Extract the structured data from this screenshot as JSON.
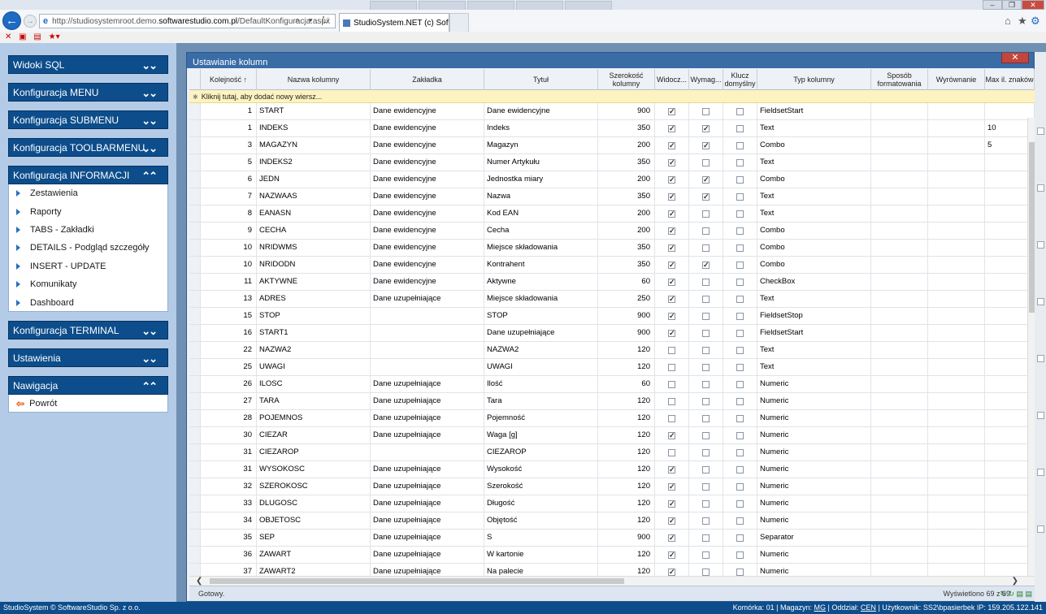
{
  "browser": {
    "url_prefix": "http://studiosystemroot.demo.",
    "url_domain": "softwarestudio.com.pl",
    "url_path": "/DefaultKonfiguracja.aspx",
    "url_tools": "⌕ ▾ ↻",
    "tab_title": "StudioSystem.NET (c) Soft...",
    "tab_close": "✕",
    "back_symbol": "←",
    "forward_symbol": "→",
    "ie_symbol": "e",
    "home_symbol": "⌂",
    "star_symbol": "★",
    "gear_symbol": "⚙",
    "favs": [
      "✕",
      "▣",
      "▤",
      "★▾"
    ]
  },
  "window": {
    "minimize": "–",
    "maximize": "❐",
    "close": "✕"
  },
  "sidebar": {
    "sections": [
      {
        "label": "Widoki SQL",
        "chevron": "⌄⌄"
      },
      {
        "label": "Konfiguracja MENU",
        "chevron": "⌄⌄"
      },
      {
        "label": "Konfiguracja SUBMENU",
        "chevron": "⌄⌄"
      },
      {
        "label": "Konfiguracja TOOLBARMENU",
        "chevron": "⌄⌄"
      },
      {
        "label": "Konfiguracja INFORMACJI",
        "chevron": "⌃⌃"
      },
      {
        "label": "Konfiguracja TERMINAL",
        "chevron": "⌄⌄"
      },
      {
        "label": "Ustawienia",
        "chevron": "⌄⌄"
      },
      {
        "label": "Nawigacja",
        "chevron": "⌃⌃"
      }
    ],
    "informacji_items": [
      "Zestawienia",
      "Raporty",
      "TABS - Zakładki",
      "DETAILS - Podgląd szczegóły",
      "INSERT - UPDATE",
      "Komunikaty",
      "Dashboard"
    ],
    "nawigacja_items": [
      "Powrót"
    ],
    "back_arrow": "⇦"
  },
  "modal": {
    "title": "Ustawianie kolumn",
    "close": "✕",
    "add_row": "Kliknij tutaj, aby dodać nowy wiersz...",
    "add_row_icon": "✱",
    "status_left": "Gotowy.",
    "status_right": "Wyświetlono 69 z 69",
    "status_icons": "↻ ↻ ▤ ▤",
    "scroll_left": "❮",
    "scroll_right": "❯"
  },
  "columns": [
    "Kolejność ↑",
    "Nazwa kolumny",
    "Zakładka",
    "Tytuł",
    "Szerokość kolumny",
    "Widocz...",
    "Wymag...",
    "Klucz domyślny",
    "Typ kolumny",
    "Sposób formatowania",
    "Wyrównanie",
    "Max il. znaków"
  ],
  "check_mark": "✓",
  "rows": [
    {
      "order": "1",
      "name": "START",
      "tab": "Dane ewidencyjne",
      "title": "Dane ewidencyjne",
      "width": "900",
      "visible": true,
      "required": false,
      "key": false,
      "type": "FieldsetStart",
      "max": ""
    },
    {
      "order": "1",
      "name": "INDEKS",
      "tab": "Dane ewidencyjne",
      "title": "Indeks",
      "width": "350",
      "visible": true,
      "required": true,
      "key": false,
      "type": "Text",
      "max": "10"
    },
    {
      "order": "3",
      "name": "MAGAZYN",
      "tab": "Dane ewidencyjne",
      "title": "Magazyn",
      "width": "200",
      "visible": true,
      "required": true,
      "key": false,
      "type": "Combo",
      "max": "5"
    },
    {
      "order": "5",
      "name": "INDEKS2",
      "tab": "Dane ewidencyjne",
      "title": "Numer Artykułu",
      "width": "350",
      "visible": true,
      "required": false,
      "key": false,
      "type": "Text",
      "max": ""
    },
    {
      "order": "6",
      "name": "JEDN",
      "tab": "Dane ewidencyjne",
      "title": "Jednostka miary",
      "width": "200",
      "visible": true,
      "required": true,
      "key": false,
      "type": "Combo",
      "max": ""
    },
    {
      "order": "7",
      "name": "NAZWAAS",
      "tab": "Dane ewidencyjne",
      "title": "Nazwa",
      "width": "350",
      "visible": true,
      "required": true,
      "key": false,
      "type": "Text",
      "max": ""
    },
    {
      "order": "8",
      "name": "EANASN",
      "tab": "Dane ewidencyjne",
      "title": "Kod EAN",
      "width": "200",
      "visible": true,
      "required": false,
      "key": false,
      "type": "Text",
      "max": ""
    },
    {
      "order": "9",
      "name": "CECHA",
      "tab": "Dane ewidencyjne",
      "title": "Cecha",
      "width": "200",
      "visible": true,
      "required": false,
      "key": false,
      "type": "Combo",
      "max": ""
    },
    {
      "order": "10",
      "name": "NRIDWMS",
      "tab": "Dane ewidencyjne",
      "title": "Miejsce składowania",
      "width": "350",
      "visible": true,
      "required": false,
      "key": false,
      "type": "Combo",
      "max": ""
    },
    {
      "order": "10",
      "name": "NRIDODN",
      "tab": "Dane ewidencyjne",
      "title": "Kontrahent",
      "width": "350",
      "visible": true,
      "required": true,
      "key": false,
      "type": "Combo",
      "max": ""
    },
    {
      "order": "11",
      "name": "AKTYWNE",
      "tab": "Dane ewidencyjne",
      "title": "Aktywne",
      "width": "60",
      "visible": true,
      "required": false,
      "key": false,
      "type": "CheckBox",
      "max": ""
    },
    {
      "order": "13",
      "name": "ADRES",
      "tab": "Dane uzupełniające",
      "title": "Miejsce składowania",
      "width": "250",
      "visible": true,
      "required": false,
      "key": false,
      "type": "Text",
      "max": ""
    },
    {
      "order": "15",
      "name": "STOP",
      "tab": "",
      "title": "STOP",
      "width": "900",
      "visible": true,
      "required": false,
      "key": false,
      "type": "FieldsetStop",
      "max": ""
    },
    {
      "order": "16",
      "name": "START1",
      "tab": "",
      "title": "Dane uzupełniające",
      "width": "900",
      "visible": true,
      "required": false,
      "key": false,
      "type": "FieldsetStart",
      "max": ""
    },
    {
      "order": "22",
      "name": "NAZWA2",
      "tab": "",
      "title": "NAZWA2",
      "width": "120",
      "visible": false,
      "required": false,
      "key": false,
      "type": "Text",
      "max": ""
    },
    {
      "order": "25",
      "name": "UWAGI",
      "tab": "",
      "title": "UWAGI",
      "width": "120",
      "visible": false,
      "required": false,
      "key": false,
      "type": "Text",
      "max": ""
    },
    {
      "order": "26",
      "name": "ILOSC",
      "tab": "Dane uzupełniające",
      "title": "Ilość",
      "width": "60",
      "visible": false,
      "required": false,
      "key": false,
      "type": "Numeric",
      "max": ""
    },
    {
      "order": "27",
      "name": "TARA",
      "tab": "Dane uzupełniające",
      "title": "Tara",
      "width": "120",
      "visible": false,
      "required": false,
      "key": false,
      "type": "Numeric",
      "max": ""
    },
    {
      "order": "28",
      "name": "POJEMNOS",
      "tab": "Dane uzupełniające",
      "title": "Pojemność",
      "width": "120",
      "visible": false,
      "required": false,
      "key": false,
      "type": "Numeric",
      "max": ""
    },
    {
      "order": "30",
      "name": "CIEZAR",
      "tab": "Dane uzupełniające",
      "title": "Waga [g]",
      "width": "120",
      "visible": true,
      "required": false,
      "key": false,
      "type": "Numeric",
      "max": ""
    },
    {
      "order": "31",
      "name": "CIEZAROP",
      "tab": "",
      "title": "CIEZAROP",
      "width": "120",
      "visible": false,
      "required": false,
      "key": false,
      "type": "Numeric",
      "max": ""
    },
    {
      "order": "31",
      "name": "WYSOKOSC",
      "tab": "Dane uzupełniające",
      "title": "Wysokość",
      "width": "120",
      "visible": true,
      "required": false,
      "key": false,
      "type": "Numeric",
      "max": ""
    },
    {
      "order": "32",
      "name": "SZEROKOSC",
      "tab": "Dane uzupełniające",
      "title": "Szerokość",
      "width": "120",
      "visible": true,
      "required": false,
      "key": false,
      "type": "Numeric",
      "max": ""
    },
    {
      "order": "33",
      "name": "DLUGOSC",
      "tab": "Dane uzupełniające",
      "title": "Długość",
      "width": "120",
      "visible": true,
      "required": false,
      "key": false,
      "type": "Numeric",
      "max": ""
    },
    {
      "order": "34",
      "name": "OBJETOSC",
      "tab": "Dane uzupełniające",
      "title": "Objętość",
      "width": "120",
      "visible": true,
      "required": false,
      "key": false,
      "type": "Numeric",
      "max": ""
    },
    {
      "order": "35",
      "name": "SEP",
      "tab": "Dane uzupełniające",
      "title": "S",
      "width": "900",
      "visible": true,
      "required": false,
      "key": false,
      "type": "Separator",
      "max": ""
    },
    {
      "order": "36",
      "name": "ZAWART",
      "tab": "Dane uzupełniające",
      "title": "W kartonie",
      "width": "120",
      "visible": true,
      "required": false,
      "key": false,
      "type": "Numeric",
      "max": ""
    },
    {
      "order": "37",
      "name": "ZAWART2",
      "tab": "Dane uzupełniające",
      "title": "Na palecie",
      "width": "120",
      "visible": true,
      "required": false,
      "key": false,
      "type": "Numeric",
      "max": ""
    }
  ],
  "statusbar": {
    "left": "StudioSystem © SoftwareStudio Sp. z o.o.",
    "komorka_label": "Komórka:",
    "komorka": "01",
    "magazyn_label": "| Magazyn:",
    "magazyn": "MG",
    "oddzial_label": "| Oddział:",
    "oddzial": "CEN",
    "user_label": "| Użytkownik:",
    "user": "SS2\\bpasierbek",
    "ip_label": "IP:",
    "ip": "159.205.122.141"
  }
}
